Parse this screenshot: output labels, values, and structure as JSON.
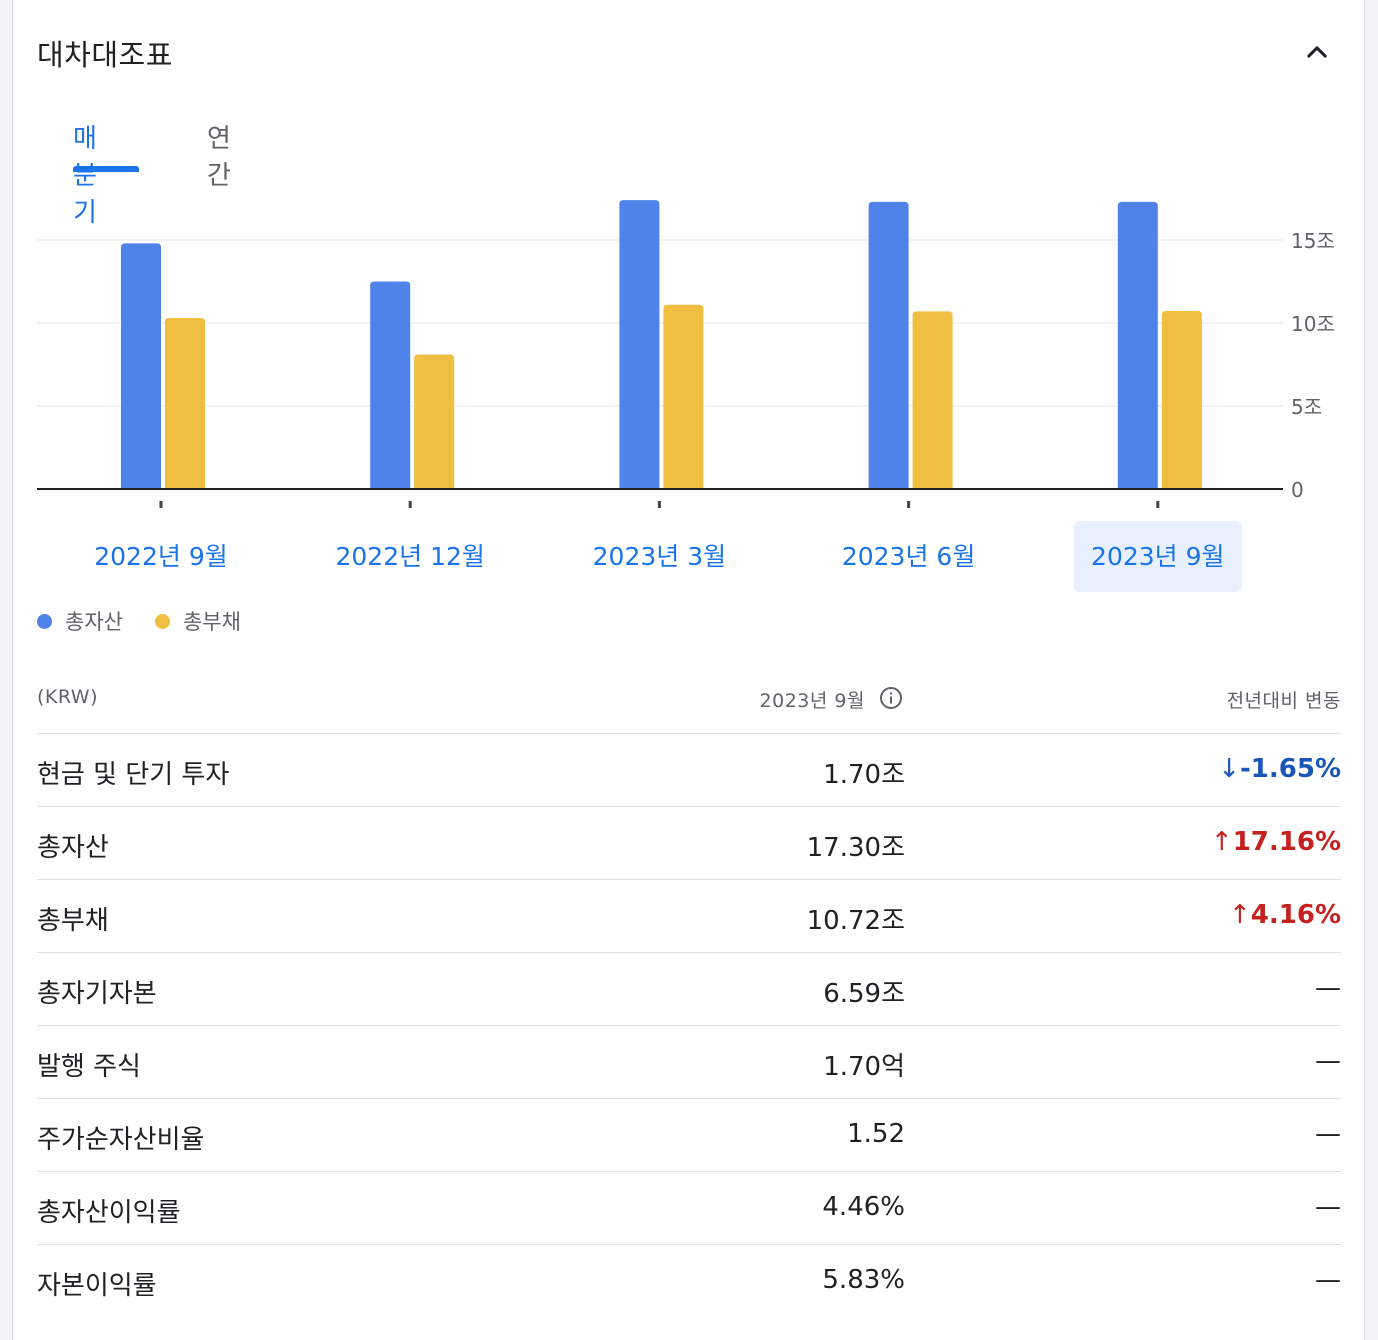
{
  "header": {
    "title": "대차대조표"
  },
  "tabs": [
    {
      "label": "매분기",
      "active": true
    },
    {
      "label": "연간",
      "active": false
    }
  ],
  "colors": {
    "assets": "#4f83ea",
    "liabilities": "#f0be40",
    "accent": "#1a73e8",
    "down": "#1a56b8",
    "up": "#c5221f",
    "selected_bg": "#e8f0fe"
  },
  "chart_data": {
    "type": "bar",
    "categories": [
      "2022년 9월",
      "2022년 12월",
      "2023년 3월",
      "2023년 6월",
      "2023년 9월"
    ],
    "selected_category": "2023년 9월",
    "series": [
      {
        "name": "총자산",
        "values": [
          14.8,
          12.5,
          17.4,
          17.3,
          17.3
        ]
      },
      {
        "name": "총부채",
        "values": [
          10.3,
          8.1,
          11.1,
          10.7,
          10.72
        ]
      }
    ],
    "y_ticks": [
      "0",
      "5조",
      "10조",
      "15조"
    ],
    "y_tick_values": [
      0,
      5,
      10,
      15
    ],
    "ylim": [
      0,
      17.4
    ],
    "grid": true,
    "legend_position": "bottom-left"
  },
  "table": {
    "currency_label": "(KRW)",
    "period_label": "2023년 9월",
    "change_label": "전년대비 변동",
    "rows": [
      {
        "label": "현금 및 단기 투자",
        "value": "1.70조",
        "change": "-1.65%",
        "direction": "down",
        "arrow": "↓"
      },
      {
        "label": "총자산",
        "value": "17.30조",
        "change": "17.16%",
        "direction": "up",
        "arrow": "↑"
      },
      {
        "label": "총부채",
        "value": "10.72조",
        "change": "4.16%",
        "direction": "up",
        "arrow": "↑"
      },
      {
        "label": "총자기자본",
        "value": "6.59조",
        "change": "—",
        "direction": "flat",
        "arrow": ""
      },
      {
        "label": "발행 주식",
        "value": "1.70억",
        "change": "—",
        "direction": "flat",
        "arrow": ""
      },
      {
        "label": "주가순자산비율",
        "value": "1.52",
        "change": "—",
        "direction": "flat",
        "arrow": ""
      },
      {
        "label": "총자산이익률",
        "value": "4.46%",
        "change": "—",
        "direction": "flat",
        "arrow": ""
      },
      {
        "label": "자본이익률",
        "value": "5.83%",
        "change": "—",
        "direction": "flat",
        "arrow": ""
      }
    ]
  }
}
